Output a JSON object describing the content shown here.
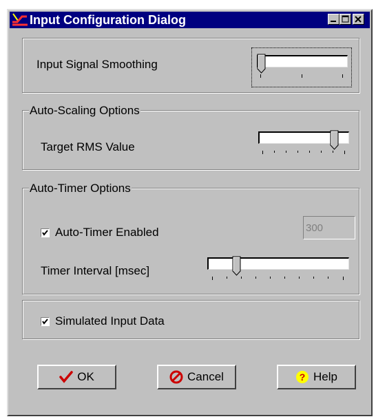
{
  "window": {
    "title": "Input Configuration Dialog",
    "title_bar_color": "#000080",
    "controls": [
      "minimize-icon",
      "maximize-icon",
      "close-icon"
    ]
  },
  "smoothing": {
    "label": "Input Signal Smoothing",
    "slider_position": 0,
    "tick_count": 3
  },
  "auto_scaling": {
    "group_title": "Auto-Scaling Options",
    "target_rms_label": "Target RMS Value",
    "slider_position": 0.83,
    "tick_count": 8
  },
  "auto_timer": {
    "group_title": "Auto-Timer Options",
    "enabled_label": "Auto-Timer Enabled",
    "enabled_checked": true,
    "interval_value": "300",
    "interval_label": "Timer Interval [msec]",
    "slider_position": 0.22,
    "tick_count": 10
  },
  "simulated": {
    "label": "Simulated Input Data",
    "checked": true
  },
  "buttons": {
    "ok": "OK",
    "cancel": "Cancel",
    "help": "Help"
  },
  "colors": {
    "ok_check": "#cc0000",
    "cancel_icon": "#cc0000",
    "help_icon_bg": "#ffff00",
    "help_icon_fg": "#cc0000"
  }
}
